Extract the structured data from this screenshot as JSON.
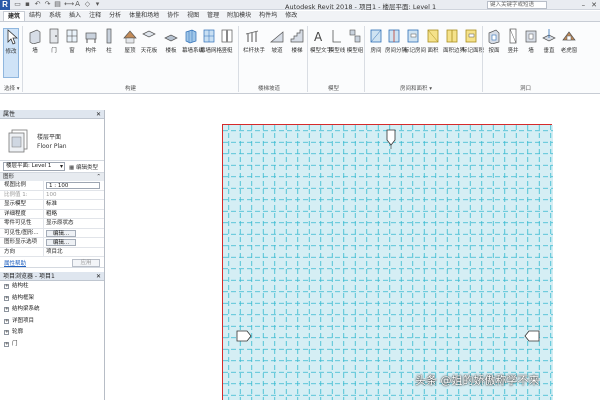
{
  "app": {
    "logo": "R",
    "title": "Autodesk Revit 2018 -    项目1 - 楼层平面: Level 1",
    "search_placeholder": "键入关键字或短语"
  },
  "tabs": [
    "建筑",
    "结构",
    "系统",
    "插入",
    "注释",
    "分析",
    "体量和场地",
    "协作",
    "视图",
    "管理",
    "附加模块",
    "构件坞",
    "修改"
  ],
  "ribbon": {
    "buttons": {
      "modify": "修改",
      "wall": "墙",
      "door": "门",
      "window": "窗",
      "component": "构件",
      "column": "柱",
      "roof": "屋顶",
      "ceiling": "天花板",
      "floor": "楼板",
      "curtain_system": "幕墙系统",
      "curtain_grid": "幕墙网格",
      "mullion": "竖梃",
      "railing": "栏杆扶手",
      "ramp": "坡道",
      "stair": "楼梯",
      "model_text": "模型文字",
      "model_line": "模型线",
      "model_group": "模型组",
      "room": "房间",
      "room_separator": "房间分隔",
      "tag_room": "标记房间",
      "area": "面积",
      "area_boundary": "面积边界",
      "tag_area": "标记面积",
      "by_face": "按面",
      "shaft": "竖井",
      "wall_opening": "墙",
      "vertical": "垂直",
      "dormer": "老虎窗"
    },
    "groups": {
      "select": "选择 ▾",
      "build": "构建",
      "circulation": "楼梯坡道",
      "model": "模型",
      "room_area": "房间和面积 ▾",
      "opening": "洞口"
    }
  },
  "properties": {
    "title": "属性",
    "type_name_cn": "楼层平面",
    "type_name_en": "Floor Plan",
    "instance_selector": "楼层平面: Level 1",
    "edit_type": "编辑类型",
    "group_graphics": "图形",
    "rows": [
      {
        "k": "视图比例",
        "v": "1 : 100",
        "style": "box"
      },
      {
        "k": "比例值 1:",
        "v": "100",
        "style": "gray"
      },
      {
        "k": "显示模型",
        "v": "标准",
        "style": ""
      },
      {
        "k": "详细程度",
        "v": "粗略",
        "style": ""
      },
      {
        "k": "零件可见性",
        "v": "显示原状态",
        "style": ""
      }
    ],
    "visibility_label": "可见性/图形...",
    "graphic_display_label": "图形显示选项",
    "edit_label": "编辑...",
    "direction_label": "方向",
    "direction_value": "项目北",
    "help_link": "属性帮助",
    "apply": "应用"
  },
  "browser": {
    "title": "项目浏览器 - 项目1",
    "items": [
      {
        "tog": "+",
        "label": "结构柱"
      },
      {
        "tog": "+",
        "label": "结构框架"
      },
      {
        "tog": "+",
        "label": "结构梁系统"
      },
      {
        "tog": "+",
        "label": "详图项目"
      },
      {
        "tog": "+",
        "label": "轮廓"
      },
      {
        "tog": "+",
        "label": "门"
      }
    ]
  },
  "watermark": "头条 @姐的娇傲称学不来",
  "colors": {
    "grid": "#35b9cf",
    "grid_fill": "#d5eef4",
    "sheet_border": "#d62a2a",
    "ribbon_blue": "#2f6fb6"
  }
}
